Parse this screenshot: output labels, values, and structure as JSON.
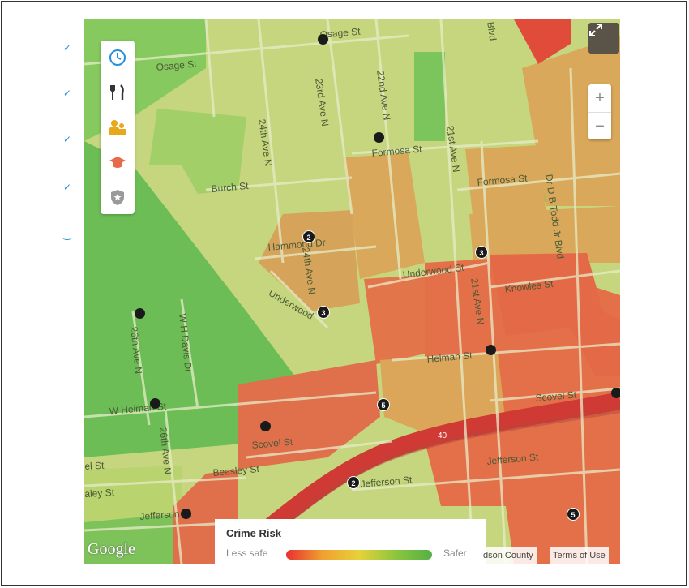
{
  "map": {
    "streets": [
      {
        "id": "osage-st-1",
        "text": "Osage St"
      },
      {
        "id": "osage-st-2",
        "text": "Osage St"
      },
      {
        "id": "23rd-ave-n",
        "text": "23rd Ave N"
      },
      {
        "id": "22nd-ave-n",
        "text": "22nd Ave N"
      },
      {
        "id": "24th-ave-n-1",
        "text": "24th Ave N"
      },
      {
        "id": "formosa-st-1",
        "text": "Formosa St"
      },
      {
        "id": "21st-ave-n-1",
        "text": "21st Ave N"
      },
      {
        "id": "formosa-st-2",
        "text": "Formosa St"
      },
      {
        "id": "burch-st",
        "text": "Burch St"
      },
      {
        "id": "dr-db-todd",
        "text": "Dr D B Todd Jr Blvd"
      },
      {
        "id": "hammond-dr",
        "text": "Hammond Dr"
      },
      {
        "id": "24th-ave-n-2",
        "text": "24th Ave N"
      },
      {
        "id": "underwood-st",
        "text": "Underwood St"
      },
      {
        "id": "underwood",
        "text": "Underwood"
      },
      {
        "id": "21st-ave-n-2",
        "text": "21st Ave N"
      },
      {
        "id": "knowles-st",
        "text": "Knowles St"
      },
      {
        "id": "26th-ave-n-1",
        "text": "26th Ave N"
      },
      {
        "id": "w-h-davis-dr",
        "text": "W H Davis Dr"
      },
      {
        "id": "helman-st",
        "text": "Helman St"
      },
      {
        "id": "w-heiman-st",
        "text": "W Heiman St"
      },
      {
        "id": "scovel-st-1",
        "text": "Scovel St"
      },
      {
        "id": "scovel-st-2",
        "text": "Scovel St"
      },
      {
        "id": "26th-ave-n-2",
        "text": "26th Ave N"
      },
      {
        "id": "beasley-st-1",
        "text": "Beasley St"
      },
      {
        "id": "el-st",
        "text": "el St"
      },
      {
        "id": "aley-st",
        "text": "aley St"
      },
      {
        "id": "jefferson-st-1",
        "text": "Jefferson St"
      },
      {
        "id": "jefferson-st-2",
        "text": "Jefferson St"
      },
      {
        "id": "jefferson-st-3",
        "text": "Jefferson St"
      },
      {
        "id": "blvd-top",
        "text": "Blvd"
      },
      {
        "id": "40-shield",
        "text": "40"
      }
    ],
    "markers": [
      {
        "id": "m1",
        "label": ""
      },
      {
        "id": "m2",
        "label": ""
      },
      {
        "id": "m3",
        "label": "2"
      },
      {
        "id": "m4",
        "label": "3"
      },
      {
        "id": "m5",
        "label": "3"
      },
      {
        "id": "m6",
        "label": ""
      },
      {
        "id": "m7",
        "label": ""
      },
      {
        "id": "m8",
        "label": ""
      },
      {
        "id": "m9",
        "label": "5"
      },
      {
        "id": "m10",
        "label": ""
      },
      {
        "id": "m11",
        "label": "2"
      },
      {
        "id": "m12",
        "label": ""
      },
      {
        "id": "m13",
        "label": "5"
      },
      {
        "id": "m14",
        "label": ""
      }
    ],
    "icons": [
      "clock-icon",
      "restaurant-icon",
      "people-icon",
      "school-icon",
      "shield-icon"
    ]
  },
  "legend": {
    "title": "Crime Risk",
    "less": "Less safe",
    "safer": "Safer"
  },
  "attribution": {
    "county": "dson County",
    "terms": "Terms of Use",
    "logo": "Google"
  },
  "colors": {
    "safe": "#55b046",
    "mid": "#e6d23a",
    "risk": "#e0643c",
    "high": "#d42f2f"
  }
}
